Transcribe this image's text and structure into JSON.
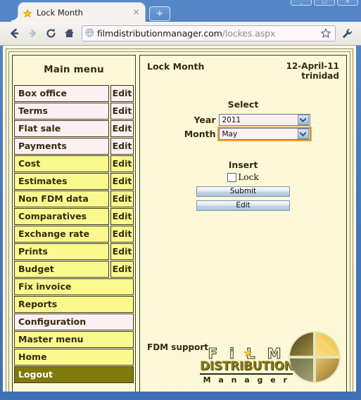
{
  "browser": {
    "tab": {
      "title": "Lock Month",
      "favicon": "star-icon",
      "close": "×"
    },
    "new_tab_label": "+",
    "nav": {
      "back": "back-arrow-icon",
      "forward": "forward-arrow-icon",
      "reload": "reload-icon",
      "home": "home-icon"
    },
    "omnibox": {
      "site_icon": "globe-icon",
      "url_domain": "filmdistributionmanager.com",
      "url_path": "/lockes.aspx",
      "bookmark": "star-outline-icon"
    },
    "menu_icon": "wrench-icon",
    "window_controls": [
      "minimize",
      "maximize",
      "close"
    ]
  },
  "sidebar": {
    "heading": "Main menu",
    "items": [
      {
        "label": "Box office",
        "edit": "Edit",
        "style": "pink"
      },
      {
        "label": "Terms",
        "edit": "Edit",
        "style": "pink"
      },
      {
        "label": "Flat sale",
        "edit": "Edit",
        "style": "pink"
      },
      {
        "label": "Payments",
        "edit": "Edit",
        "style": "pink"
      },
      {
        "label": "Cost",
        "edit": "Edit",
        "style": "yellow"
      },
      {
        "label": "Estimates",
        "edit": "Edit",
        "style": "yellow"
      },
      {
        "label": "Non FDM data",
        "edit": "Edit",
        "style": "yellow"
      },
      {
        "label": "Comparatives",
        "edit": "Edit",
        "style": "yellow"
      },
      {
        "label": "Exchange rate",
        "edit": "Edit",
        "style": "yellow"
      },
      {
        "label": "Prints",
        "edit": "Edit",
        "style": "yellow"
      },
      {
        "label": "Budget",
        "edit": "Edit",
        "style": "yellow"
      },
      {
        "label": "Fix invoice",
        "edit": null,
        "style": "yellow"
      },
      {
        "label": "Reports",
        "edit": null,
        "style": "yellow"
      },
      {
        "label": "Configuration",
        "edit": null,
        "style": "pink"
      },
      {
        "label": "Master menu",
        "edit": null,
        "style": "yellow"
      },
      {
        "label": "Home",
        "edit": null,
        "style": "yellow"
      },
      {
        "label": "Logout",
        "edit": null,
        "style": "logout"
      }
    ]
  },
  "content": {
    "title": "Lock Month",
    "date": "12-April-11",
    "user": "trinidad",
    "select_heading": "Select",
    "year_label": "Year",
    "year_value": "2011",
    "month_label": "Month",
    "month_value": "May",
    "insert_heading": "Insert",
    "lock_label": "Lock",
    "lock_checked": false,
    "submit_label": "Submit",
    "edit_label": "Edit",
    "support_text": "FDM support"
  },
  "logo": {
    "line1": "F i L M",
    "line2": "DISTRIBUTION",
    "line3": "M a n a g e r",
    "sphere": {
      "top_left": "#6f6326",
      "top_right": "#f5cf54",
      "bottom_left": "#8d8f5d",
      "bottom_right": "#c9a24c"
    }
  },
  "colors": {
    "page_bg": "#fcf8d8",
    "menu_yellow": "#fbf88e",
    "menu_pink": "#fdf0f3",
    "logout_bg": "#80790c",
    "text_dark": "#332d10",
    "focus_ring": "#f0a830",
    "chrome_blue": "#3f6fb4"
  }
}
